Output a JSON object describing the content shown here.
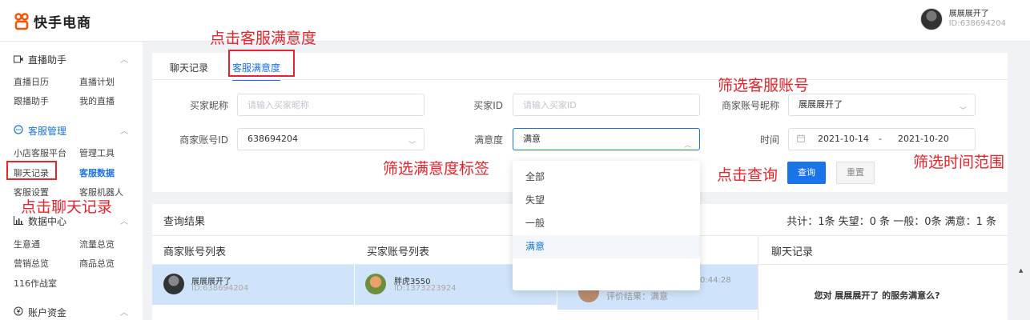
{
  "header": {
    "app_name": "快手电商",
    "user_name": "展展展开了",
    "user_id": "ID:638694204"
  },
  "sidebar": {
    "groups": [
      {
        "title": "直播助手",
        "icon": "video-icon",
        "links": [
          "直播日历",
          "直播计划",
          "跟播助手",
          "我的直播"
        ]
      },
      {
        "title": "客服管理",
        "icon": "chat-bubble-icon",
        "links": [
          "小店客服平台",
          "管理工具",
          "聊天记录",
          "客服数据",
          "客服设置",
          "客服机器人"
        ]
      },
      {
        "title": "数据中心",
        "icon": "bar-chart-icon",
        "links": [
          "生意通",
          "流量总览",
          "营销总览",
          "商品总览",
          "116作战室"
        ]
      },
      {
        "title": "账户资金",
        "icon": "yen-icon",
        "links": []
      }
    ]
  },
  "tabs": [
    "聊天记录",
    "客服满意度"
  ],
  "filters": {
    "buyer_nickname_label": "买家昵称",
    "buyer_nickname_placeholder": "请输入买家昵称",
    "buyer_id_label": "买家ID",
    "buyer_id_placeholder": "请输入买家ID",
    "merchant_nickname_label": "商家账号昵称",
    "merchant_nickname_value": "展展展开了",
    "merchant_id_label": "商家账号ID",
    "merchant_id_value": "638694204",
    "satisfaction_label": "满意度",
    "satisfaction_value": "满意",
    "time_label": "时间",
    "date_start": "2021-10-14",
    "date_sep": "-",
    "date_end": "2021-10-20",
    "query_button": "查询",
    "reset_button": "重置"
  },
  "dropdown_options": [
    "全部",
    "失望",
    "一般",
    "满意"
  ],
  "results": {
    "title": "查询结果",
    "stat": "共计：1条 失望：0 条 一般：0条 满意：1 条",
    "columns": [
      "商家账号列表",
      "买家账号列表",
      "聊天记录"
    ],
    "merchant_row": {
      "name": "展展展开了",
      "id": "ID:638694204"
    },
    "buyer_row": {
      "name": "胖虎3550",
      "id": "ID:1373223924"
    },
    "session_time": "0:44:28",
    "session_result": "评价结果：满意",
    "chat_question": "您对 展展展开了 的服务满意么?"
  },
  "annotations": {
    "tab": "点击客服满意度",
    "sidebar": "点击聊天记录",
    "account": "筛选客服账号",
    "tag": "筛选满意度标签",
    "query": "点击查询",
    "time": "筛选时间范围"
  },
  "colors": {
    "accent": "#1a73e8",
    "annotation": "#e8232a",
    "brand": "#ff5000"
  }
}
